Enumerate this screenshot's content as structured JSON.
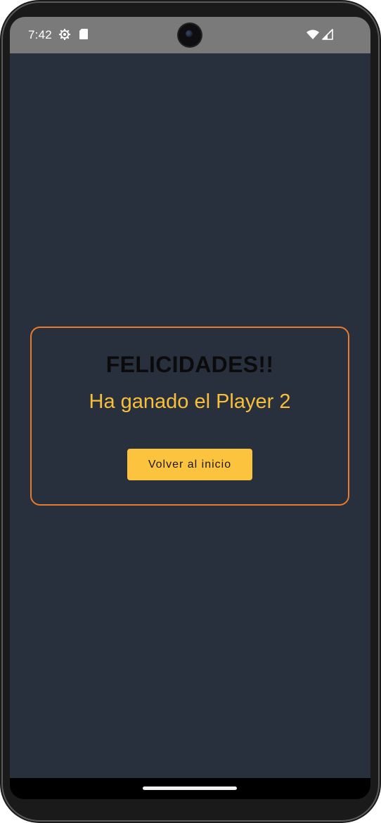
{
  "status_bar": {
    "time": "7:42",
    "icons": [
      "settings-gear-icon",
      "sd-card-icon",
      "wifi-icon",
      "cellular-signal-icon"
    ]
  },
  "dialog": {
    "title": "FELICIDADES!!",
    "message": "Ha ganado el Player 2",
    "button_label": "Volver al inicio"
  },
  "colors": {
    "background": "#28303d",
    "border_accent": "#e87b2f",
    "message_text": "#f7bf3a",
    "button_fill": "#fcc33e",
    "title_text": "#0b0b0b"
  }
}
